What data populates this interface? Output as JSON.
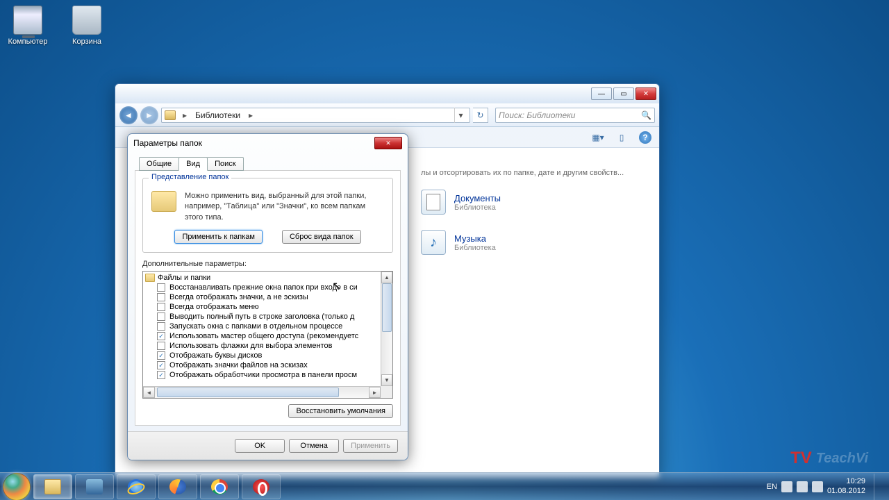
{
  "desktop": {
    "computer": "Компьютер",
    "trash": "Корзина"
  },
  "explorer": {
    "breadcrumb": [
      "Библиотеки"
    ],
    "search_placeholder": "Поиск: Библиотеки",
    "desc": "лы и отсортировать их по папке, дате и другим свойств...",
    "libs": [
      {
        "title": "Документы",
        "sub": "Библиотека",
        "kind": "doc"
      },
      {
        "title": "Музыка",
        "sub": "Библиотека",
        "kind": "mus"
      }
    ]
  },
  "dialog": {
    "title": "Параметры папок",
    "tabs": [
      "Общие",
      "Вид",
      "Поиск"
    ],
    "active_tab": 1,
    "group_title": "Представление папок",
    "group_text": "Можно применить вид, выбранный для этой папки, например, \"Таблица\" или \"Значки\", ко всем папкам этого типа.",
    "apply_folders": "Применить к папкам",
    "reset_folders": "Сброс вида папок",
    "adv_label": "Дополнительные параметры:",
    "tree_root": "Файлы и папки",
    "tree_items": [
      {
        "checked": false,
        "label": "Восстанавливать прежние окна папок при входе в си"
      },
      {
        "checked": false,
        "label": "Всегда отображать значки, а не эскизы"
      },
      {
        "checked": false,
        "label": "Всегда отображать меню"
      },
      {
        "checked": false,
        "label": "Выводить полный путь в строке заголовка (только д"
      },
      {
        "checked": false,
        "label": "Запускать окна с папками в отдельном процессе"
      },
      {
        "checked": true,
        "label": "Использовать мастер общего доступа (рекомендуетс"
      },
      {
        "checked": false,
        "label": "Использовать флажки для выбора элементов"
      },
      {
        "checked": true,
        "label": "Отображать буквы дисков"
      },
      {
        "checked": true,
        "label": "Отображать значки файлов на эскизах"
      },
      {
        "checked": true,
        "label": "Отображать обработчики просмотра в панели просм"
      }
    ],
    "restore_defaults": "Восстановить умолчания",
    "ok": "OK",
    "cancel": "Отмена",
    "apply": "Применить"
  },
  "taskbar": {
    "lang": "EN",
    "time": "10:29",
    "date": "01.08.2012"
  },
  "watermark": "TeachVi"
}
